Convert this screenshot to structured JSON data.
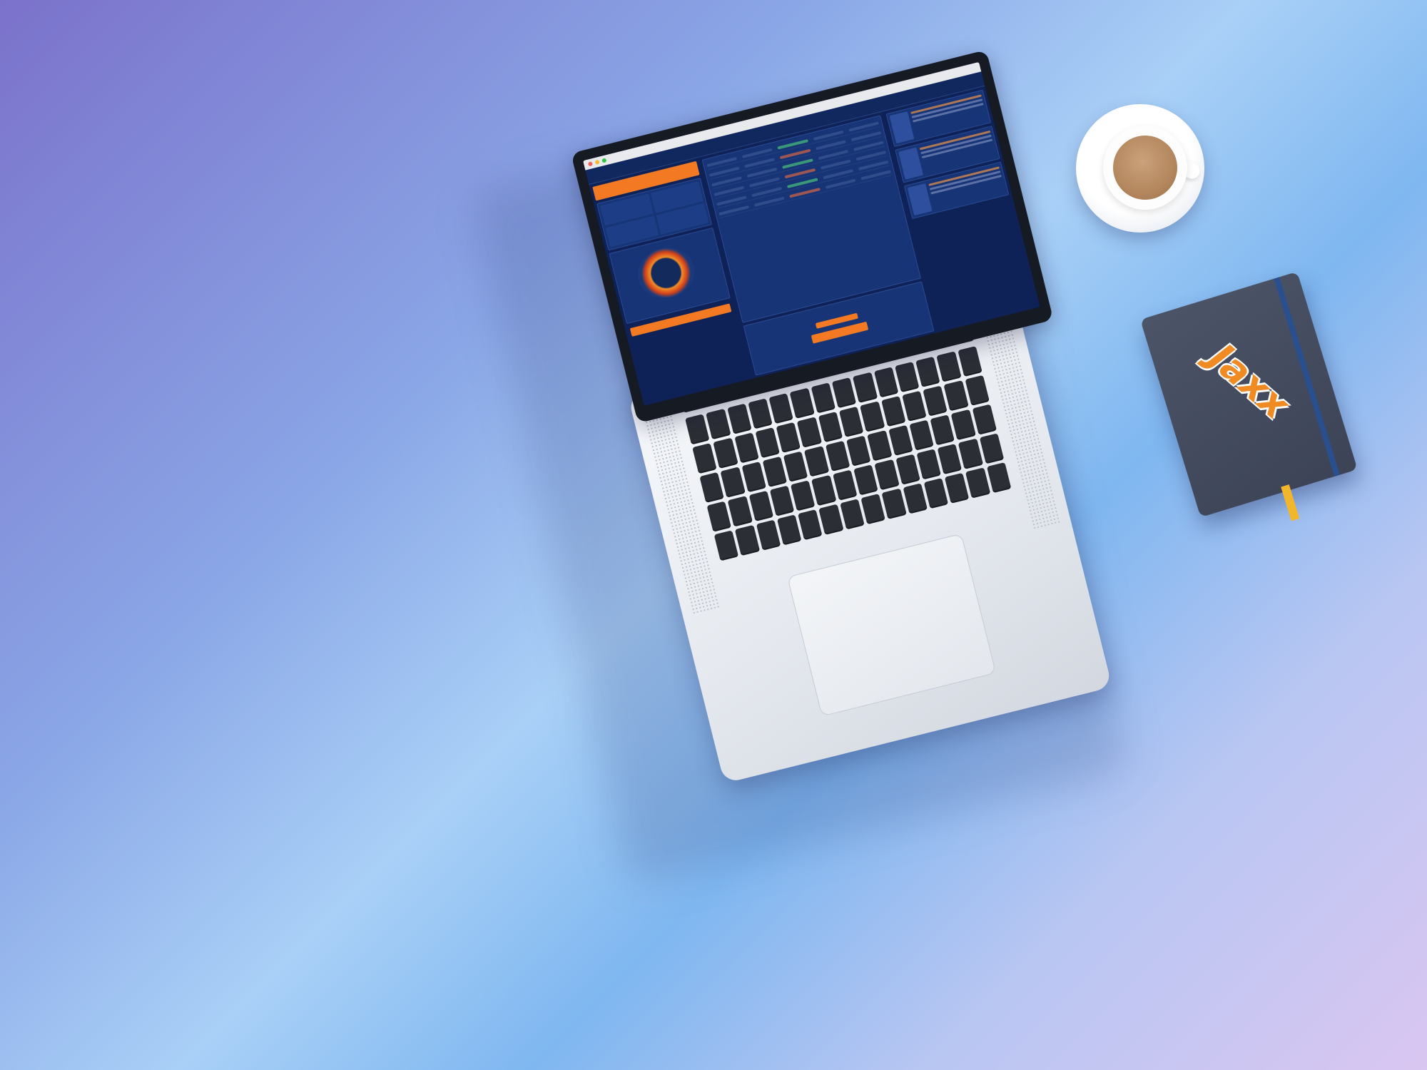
{
  "notebook": {
    "logo_text": "Jaxx"
  },
  "icons": {
    "laptop": "laptop-icon",
    "coffee": "coffee-cup-icon",
    "notebook": "notebook-icon"
  },
  "colors": {
    "background_top_left": "#7b72cb",
    "background_center": "#a9d0f7",
    "background_bottom_right": "#d9c6f1",
    "app_navy": "#0f2257",
    "accent_orange": "#f37a22",
    "ribbon_yellow": "#f2b62c"
  }
}
